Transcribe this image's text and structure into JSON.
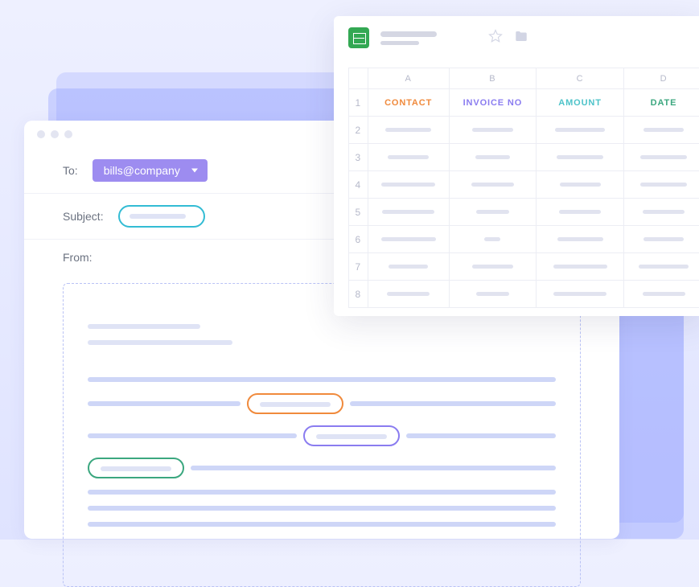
{
  "email": {
    "to_label": "To:",
    "to_value": "bills@company",
    "subject_label": "Subject:",
    "from_label": "From:"
  },
  "sheet": {
    "col_letters": [
      "A",
      "B",
      "C",
      "D"
    ],
    "headers": {
      "contact": "CONTACT",
      "invoice": "INVOICE NO",
      "amount": "AMOUNT",
      "date": "DATE"
    },
    "row_numbers": [
      "1",
      "2",
      "3",
      "4",
      "5",
      "6",
      "7",
      "8"
    ]
  },
  "highlights": {
    "subject_color": "#33bcd4",
    "contact_color": "#f08a3c",
    "invoice_color": "#8a7cf0",
    "amount_color": "#4dc3c9",
    "date_color": "#3ba77f"
  }
}
